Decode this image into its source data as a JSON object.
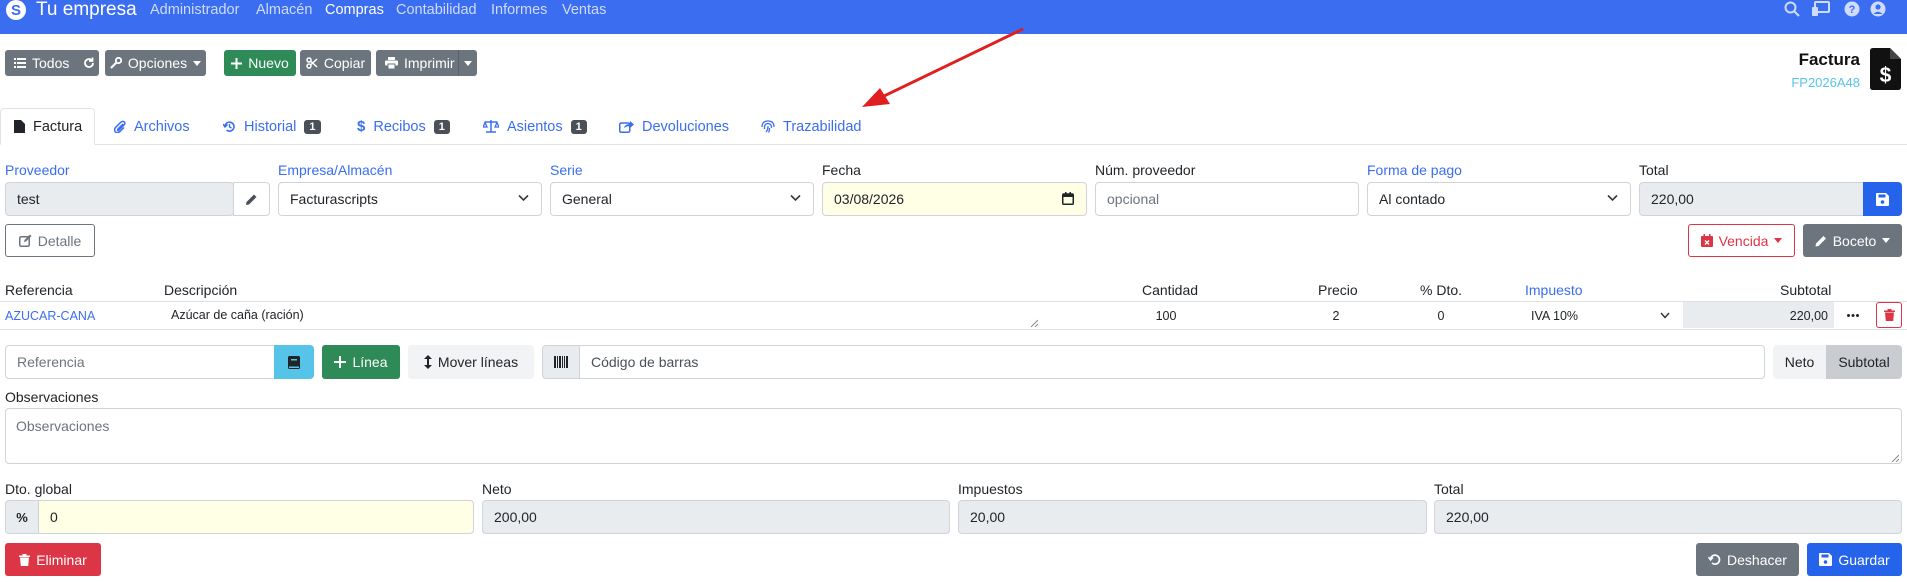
{
  "navbar": {
    "brand": "Tu empresa",
    "items": [
      "Administrador",
      "Almacén",
      "Compras",
      "Contabilidad",
      "Informes",
      "Ventas"
    ],
    "active": "Compras"
  },
  "toolbar": {
    "todos": "Todos",
    "opciones": "Opciones",
    "nuevo": "Nuevo",
    "copiar": "Copiar",
    "imprimir": "Imprimir"
  },
  "document": {
    "title": "Factura",
    "code": "FP2026A48"
  },
  "tabs": [
    {
      "label": "Factura",
      "icon": "file-icon",
      "badge": ""
    },
    {
      "label": "Archivos",
      "icon": "paperclip-icon",
      "badge": ""
    },
    {
      "label": "Historial",
      "icon": "history-icon",
      "badge": "1"
    },
    {
      "label": "Recibos",
      "icon": "dollar-icon",
      "badge": "1"
    },
    {
      "label": "Asientos",
      "icon": "balance-scale-icon",
      "badge": "1"
    },
    {
      "label": "Devoluciones",
      "icon": "share-icon",
      "badge": ""
    },
    {
      "label": "Trazabilidad",
      "icon": "fingerprint-icon",
      "badge": ""
    }
  ],
  "form": {
    "proveedor": {
      "label": "Proveedor",
      "value": "test"
    },
    "empresa": {
      "label": "Empresa/Almacén",
      "value": "Facturascripts"
    },
    "serie": {
      "label": "Serie",
      "value": "General"
    },
    "fecha": {
      "label": "Fecha",
      "value": "03/08/2026"
    },
    "num_proveedor": {
      "label": "Núm. proveedor",
      "placeholder": "opcional"
    },
    "forma_pago": {
      "label": "Forma de pago",
      "value": "Al contado"
    },
    "total": {
      "label": "Total",
      "value": "220,00"
    }
  },
  "buttons": {
    "detalle": "Detalle",
    "vencida": "Vencida",
    "boceto": "Boceto",
    "linea": "Línea",
    "mover_lineas": "Mover líneas",
    "neto": "Neto",
    "subtotal": "Subtotal",
    "eliminar": "Eliminar",
    "deshacer": "Deshacer",
    "guardar": "Guardar"
  },
  "lines": {
    "headers": {
      "referencia": "Referencia",
      "descripcion": "Descripción",
      "cantidad": "Cantidad",
      "precio": "Precio",
      "dto": "% Dto.",
      "impuesto": "Impuesto",
      "subtotal": "Subtotal"
    },
    "rows": [
      {
        "referencia": "AZUCAR-CANA",
        "descripcion": "Azúcar de caña (ración)",
        "cantidad": "100",
        "precio": "2",
        "dto": "0",
        "impuesto": "IVA 10%",
        "subtotal": "220,00"
      }
    ]
  },
  "add_line": {
    "referencia_placeholder": "Referencia",
    "barcode_placeholder": "Código de barras"
  },
  "observaciones": {
    "label": "Observaciones",
    "placeholder": "Observaciones"
  },
  "totals": {
    "dto_global": {
      "label": "Dto. global",
      "value": "0"
    },
    "neto": {
      "label": "Neto",
      "value": "200,00"
    },
    "impuestos": {
      "label": "Impuestos",
      "value": "20,00"
    },
    "total": {
      "label": "Total",
      "value": "220,00"
    }
  },
  "colors": {
    "navbar": "#3a6df0",
    "accent_link": "#3a6df0",
    "success": "#2e8b57",
    "danger": "#dc3545",
    "secondary": "#6c757d",
    "info": "#55c4e8",
    "annotation_arrow": "#e02020"
  }
}
